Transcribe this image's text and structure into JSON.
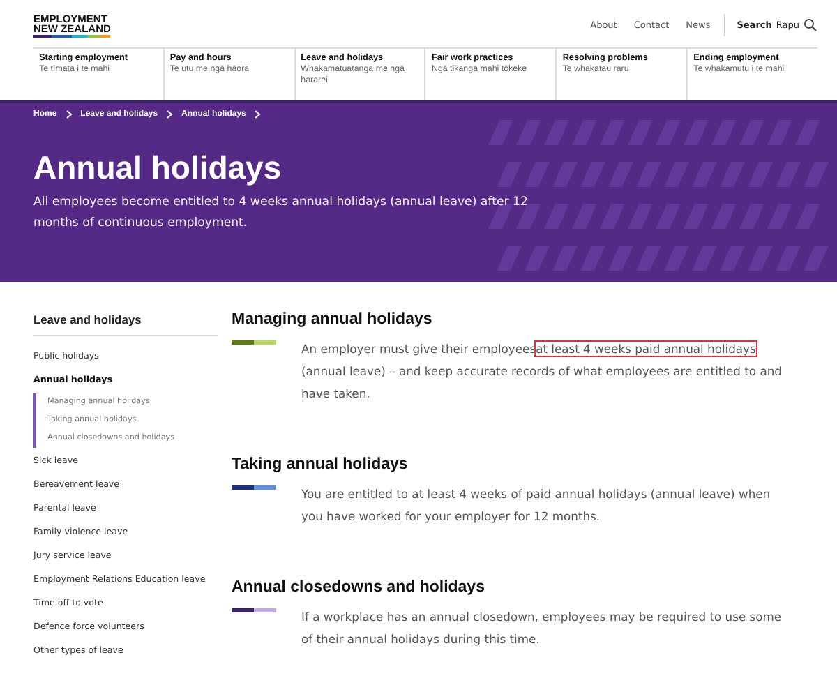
{
  "header": {
    "logo": [
      "EMPLOYMENT",
      "NEW ZEALAND"
    ],
    "links": [
      "About",
      "Contact",
      "News"
    ],
    "search": {
      "label": "Search",
      "sublabel": "Rapu"
    }
  },
  "nav": [
    {
      "title": "Starting employment",
      "subtitle": "Te tīmata i te mahi"
    },
    {
      "title": "Pay and hours",
      "subtitle": "Te utu me ngā hāora"
    },
    {
      "title": "Leave and holidays",
      "subtitle": "Whakamatuatanga me ngā hararei"
    },
    {
      "title": "Fair work practices",
      "subtitle": "Ngā tikanga mahi tōkeke"
    },
    {
      "title": "Resolving problems",
      "subtitle": "Te whakatau raru"
    },
    {
      "title": "Ending employment",
      "subtitle": "Te whakamutu i te mahi"
    }
  ],
  "breadcrumb": [
    "Home",
    "Leave and holidays",
    "Annual holidays"
  ],
  "banner": {
    "title": "Annual holidays",
    "description": "All employees become entitled to 4 weeks annual holidays (annual leave) after 12 months of continuous employment."
  },
  "sidebar": {
    "title": "Leave and holidays",
    "items": [
      {
        "label": "Public holidays",
        "selected": false
      },
      {
        "label": "Annual holidays",
        "selected": true,
        "children": [
          {
            "label": "Managing annual holidays"
          },
          {
            "label": "Taking annual holidays"
          },
          {
            "label": "Annual closedowns and holidays"
          }
        ]
      },
      {
        "label": "Sick leave",
        "selected": false
      },
      {
        "label": "Bereavement leave",
        "selected": false
      },
      {
        "label": "Parental leave",
        "selected": false
      },
      {
        "label": "Family violence leave",
        "selected": false
      },
      {
        "label": "Jury service leave",
        "selected": false
      },
      {
        "label": "Employment Relations Education leave",
        "selected": false
      },
      {
        "label": "Time off to vote",
        "selected": false
      },
      {
        "label": "Defence force volunteers",
        "selected": false
      },
      {
        "label": "Other types of leave",
        "selected": false
      }
    ]
  },
  "sections": [
    {
      "heading": "Managing annual holidays",
      "accent": [
        {
          "color": "#5a7d14"
        },
        {
          "color": "#b8d85c"
        }
      ],
      "text": [
        {
          "text": "An employer must give their employees",
          "highlighted": false
        },
        {
          "text": "at least 4 weeks paid annual holidays",
          "highlighted": true
        },
        {
          "text": " (annual leave) – and keep accurate records of what employees are entitled to and have taken.",
          "highlighted": false
        }
      ]
    },
    {
      "heading": "Taking annual holidays",
      "accent": [
        {
          "color": "#1c2f80"
        },
        {
          "color": "#5b8fe0"
        }
      ],
      "text": [
        {
          "text": "You are entitled to at least 4 weeks of paid annual holidays (annual leave) when you have worked for your employer for 12 months.",
          "highlighted": false
        }
      ]
    },
    {
      "heading": "Annual closedowns and holidays",
      "accent": [
        {
          "color": "#3b1e6e"
        },
        {
          "color": "#c2aee3"
        }
      ],
      "text": [
        {
          "text": "If a workplace has an annual closedown, employees may be required to use some of their annual holidays during this time.",
          "highlighted": false
        }
      ]
    }
  ]
}
